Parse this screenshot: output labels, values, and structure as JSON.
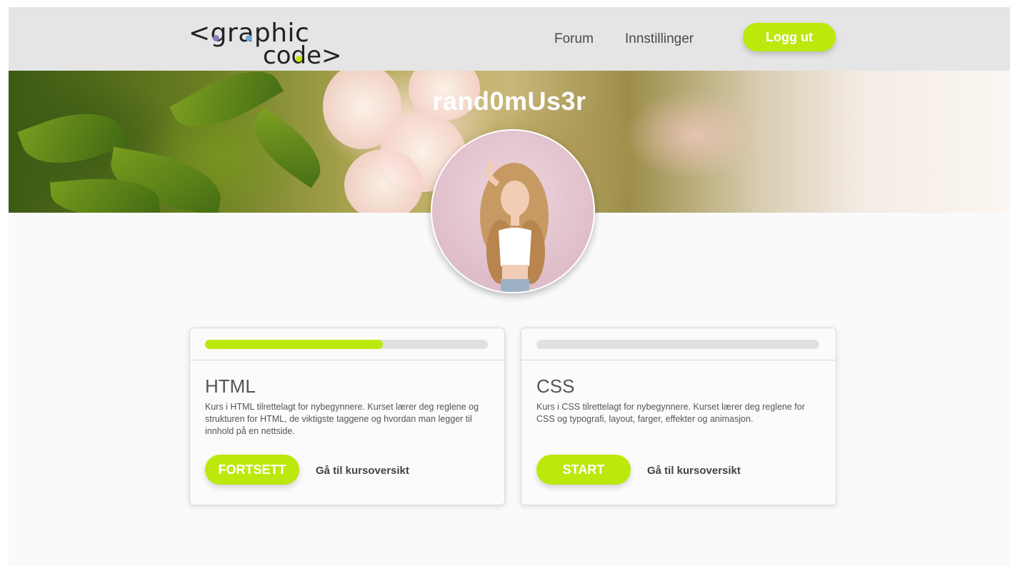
{
  "header": {
    "logo": {
      "line1": "<graphic",
      "line2": "code>"
    },
    "nav": {
      "forum": "Forum",
      "settings": "Innstillinger"
    },
    "logout_label": "Logg ut"
  },
  "profile": {
    "username": "rand0mUs3r"
  },
  "courses": [
    {
      "title": "HTML",
      "description": "Kurs i HTML tilrettelagt for nybegynnere. Kurset lærer deg reglene og strukturen for HTML, de viktigste taggene og hvordan man legger til innhold på en nettside.",
      "button_label": "FORTSETT",
      "overview_label": "Gå til kursoversikt",
      "progress": 0.63
    },
    {
      "title": "CSS",
      "description": "Kurs i CSS tilrettelagt for nybegynnere. Kurset lærer deg reglene for CSS og typografi, layout, farger, effekter og animasjon.",
      "button_label": "START",
      "overview_label": "Gå til kursoversikt",
      "progress": 0
    }
  ],
  "colors": {
    "accent": "#bde80c",
    "header_bg": "#e5e5e5",
    "track": "#dfe1e2"
  }
}
